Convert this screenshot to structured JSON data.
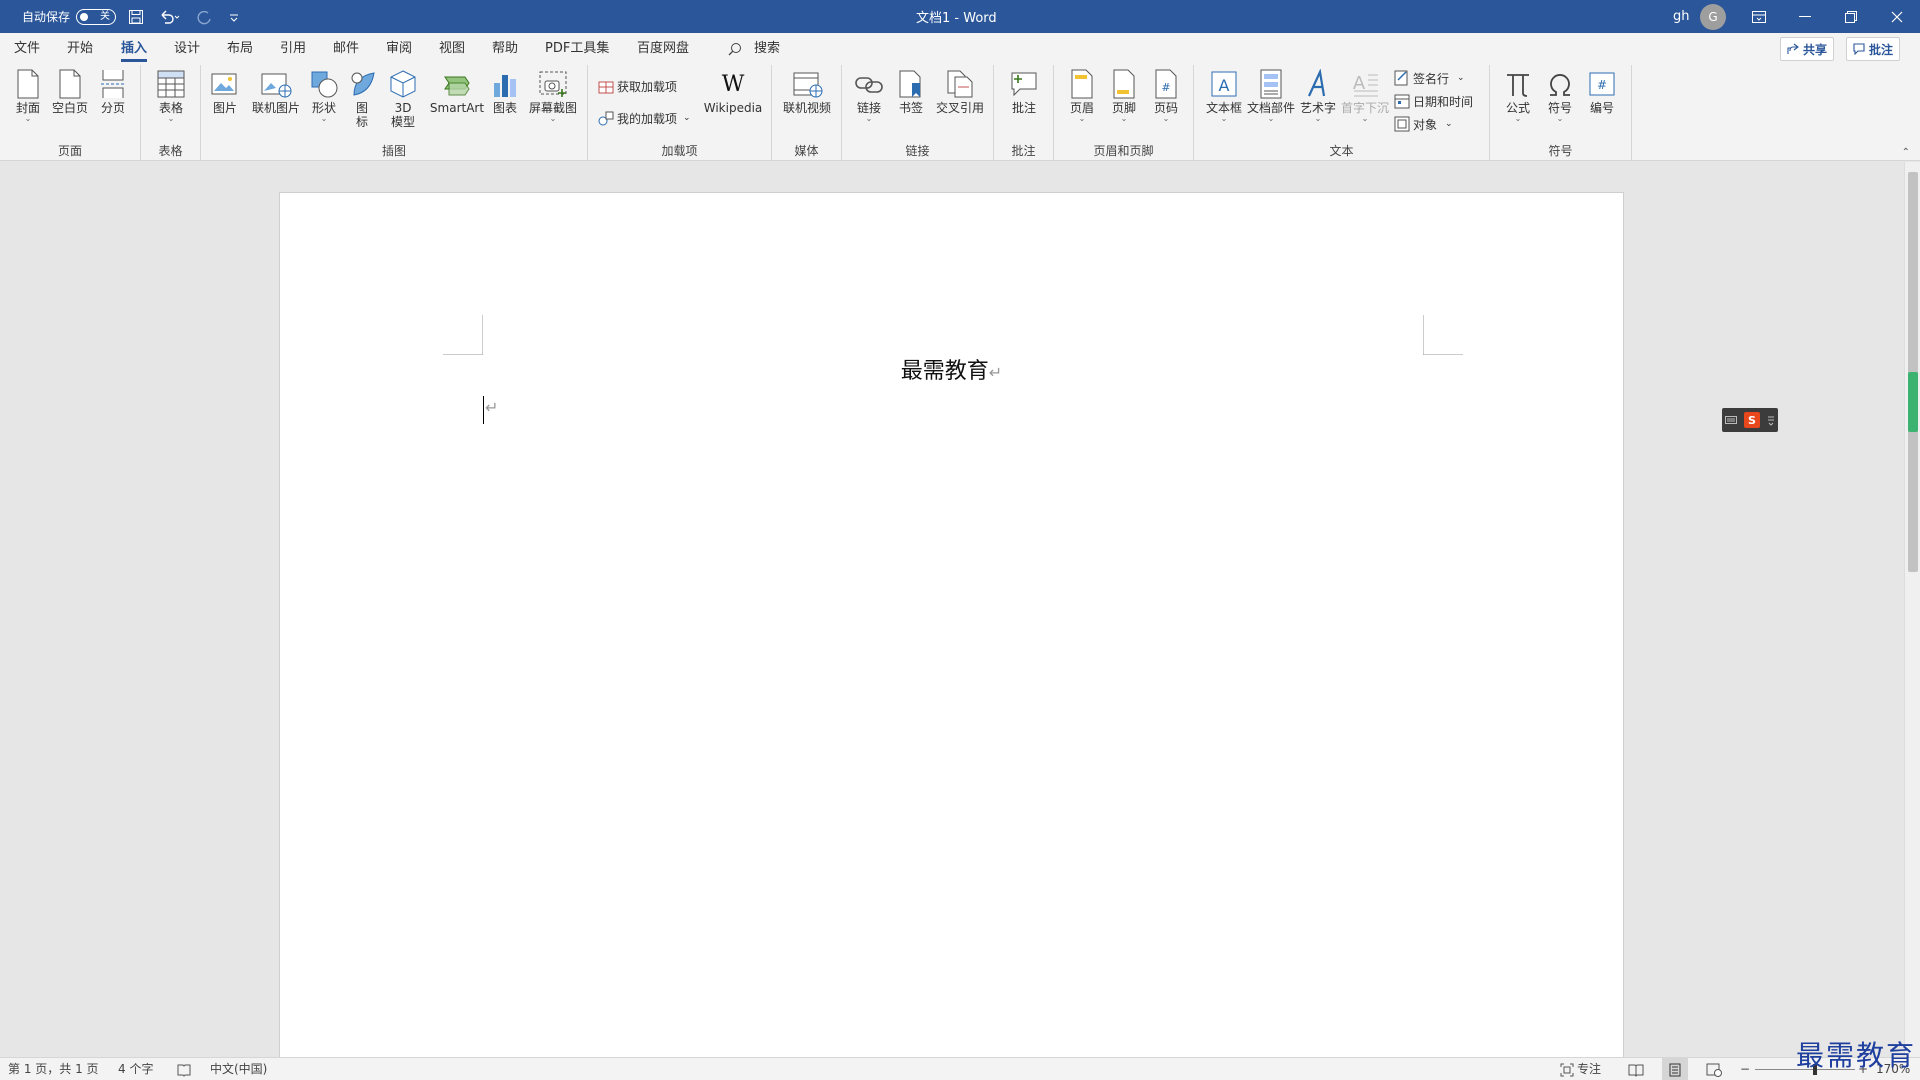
{
  "titlebar": {
    "autosave_label": "自动保存",
    "autosave_state": "关",
    "doc_title": "文档1 - Word",
    "user_initials": "gh",
    "avatar_letter": "G"
  },
  "menu": {
    "tabs": [
      "文件",
      "开始",
      "插入",
      "设计",
      "布局",
      "引用",
      "邮件",
      "审阅",
      "视图",
      "帮助",
      "PDF工具集",
      "百度网盘"
    ],
    "active": "插入",
    "search": "搜索",
    "share": "共享",
    "comment": "批注"
  },
  "ribbon": {
    "groups": {
      "pages": "页面",
      "tables": "表格",
      "illustrations": "插图",
      "addins": "加载项",
      "media": "媒体",
      "links": "链接",
      "comments": "批注",
      "header_footer": "页眉和页脚",
      "text": "文本",
      "symbols": "符号"
    },
    "buttons": {
      "cover": "封面",
      "blank_page": "空白页",
      "page_break": "分页",
      "table": "表格",
      "picture": "图片",
      "online_picture": "联机图片",
      "shapes": "形状",
      "icons_1": "图",
      "icons_2": "标",
      "model3d_1": "3D",
      "model3d_2": "模型",
      "smartart": "SmartArt",
      "chart": "图表",
      "screenshot": "屏幕截图",
      "get_addins": "获取加载项",
      "my_addins": "我的加载项",
      "wikipedia": "Wikipedia",
      "online_video": "联机视频",
      "link": "链接",
      "bookmark": "书签",
      "cross_ref": "交叉引用",
      "comment": "批注",
      "header": "页眉",
      "footer": "页脚",
      "page_number": "页码",
      "textbox": "文本框",
      "quick_parts": "文档部件",
      "wordart": "艺术字",
      "drop_cap": "首字下沉",
      "signature": "签名行",
      "datetime": "日期和时间",
      "object": "对象",
      "equation": "公式",
      "symbol": "符号",
      "number": "编号"
    }
  },
  "document": {
    "title": "最需教育"
  },
  "status": {
    "page": "第 1 页，共 1 页",
    "words": "4 个字",
    "language": "中文(中国)",
    "focus": "专注",
    "zoom": "170%"
  },
  "watermark": "最需教育",
  "colors": {
    "brand": "#2b579a",
    "ribbon_bg": "#f3f3f3",
    "canvas_bg": "#e6e6e6"
  }
}
